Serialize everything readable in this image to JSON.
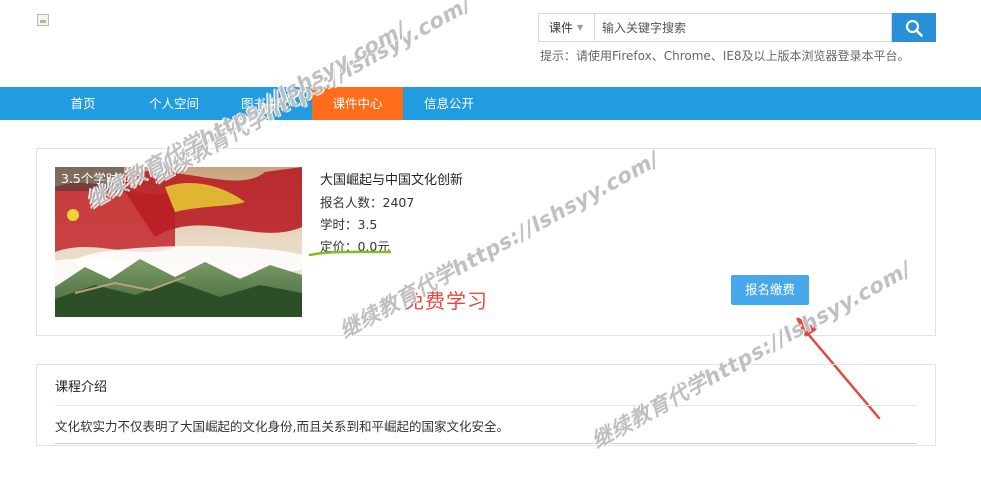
{
  "header": {
    "search": {
      "type_label": "课件",
      "placeholder": "输入关键字搜索"
    },
    "hint": "提示：请使用Firefox、Chrome、IE8及以上版本浏览器登录本平台。"
  },
  "nav": {
    "items": [
      "首页",
      "个人空间",
      "图书中心",
      "课件中心",
      "信息公开"
    ],
    "active": "课件中心"
  },
  "course": {
    "hours_badge": "3.5个学时",
    "title": "大国崛起与中国文化创新",
    "enrolled": "报名人数：2407",
    "hours": "学时：3.5",
    "price": "定价：0.0元",
    "enroll_button": "报名缴费"
  },
  "annotation": {
    "free_text": "免费学习"
  },
  "intro": {
    "title": "课程介绍",
    "text": "文化软实力不仅表明了大国崛起的文化身份,而且关系到和平崛起的国家文化安全。"
  },
  "watermark": {
    "text": "继续教育代学https://lshsyy.com/"
  },
  "colors": {
    "nav_bg": "#229ce0",
    "nav_active": "#ff6d1a",
    "search_button": "#2a8fd9",
    "enroll_button": "#46a8ea",
    "free_text": "#e5483f",
    "underline_mark": "#7dc31f",
    "arrow": "#e5483f"
  },
  "icons": {
    "search": "search-icon",
    "logo": "broken-image-icon"
  }
}
